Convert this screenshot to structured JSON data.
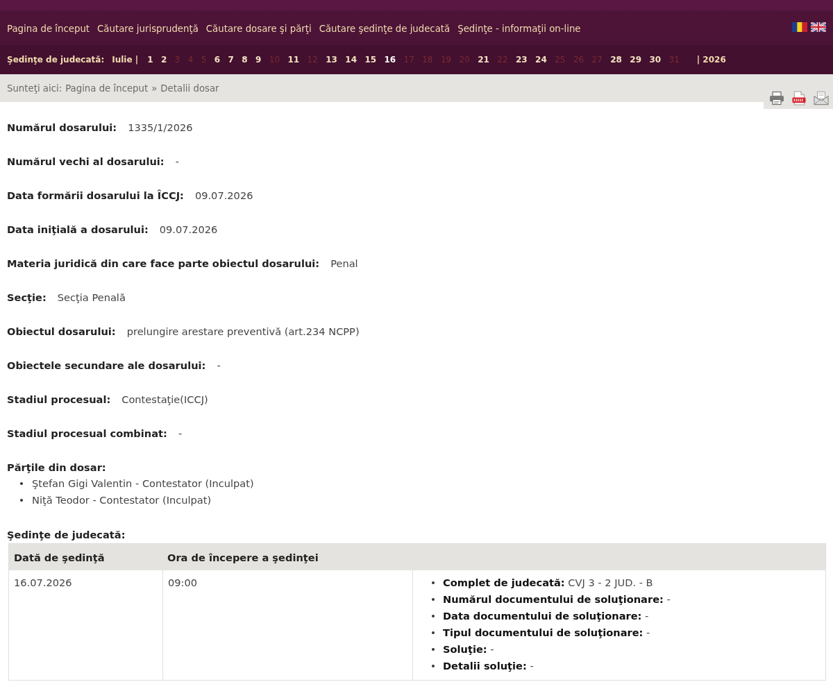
{
  "top_nav": {
    "items": [
      "Pagina de început",
      "Căutare jurisprudenţă",
      "Căutare dosare şi părţi",
      "Căutare şedinţe de judecată",
      "Şedinţe - informaţii on-line"
    ]
  },
  "sessions_nav": {
    "label": "Şedinţe de judecată:",
    "month": "Iulie |",
    "days": [
      {
        "day": "1",
        "has_sessions": true,
        "selected": false
      },
      {
        "day": "2",
        "has_sessions": true,
        "selected": false
      },
      {
        "day": "3",
        "has_sessions": false,
        "selected": false
      },
      {
        "day": "4",
        "has_sessions": false,
        "selected": false
      },
      {
        "day": "5",
        "has_sessions": false,
        "selected": false
      },
      {
        "day": "6",
        "has_sessions": true,
        "selected": false
      },
      {
        "day": "7",
        "has_sessions": true,
        "selected": false
      },
      {
        "day": "8",
        "has_sessions": true,
        "selected": false
      },
      {
        "day": "9",
        "has_sessions": true,
        "selected": false
      },
      {
        "day": "10",
        "has_sessions": false,
        "selected": false
      },
      {
        "day": "11",
        "has_sessions": true,
        "selected": false
      },
      {
        "day": "12",
        "has_sessions": false,
        "selected": false
      },
      {
        "day": "13",
        "has_sessions": true,
        "selected": false
      },
      {
        "day": "14",
        "has_sessions": true,
        "selected": false
      },
      {
        "day": "15",
        "has_sessions": true,
        "selected": false
      },
      {
        "day": "16",
        "has_sessions": true,
        "selected": true
      },
      {
        "day": "17",
        "has_sessions": false,
        "selected": false
      },
      {
        "day": "18",
        "has_sessions": false,
        "selected": false
      },
      {
        "day": "19",
        "has_sessions": false,
        "selected": false
      },
      {
        "day": "20",
        "has_sessions": false,
        "selected": false
      },
      {
        "day": "21",
        "has_sessions": true,
        "selected": false
      },
      {
        "day": "22",
        "has_sessions": false,
        "selected": false
      },
      {
        "day": "23",
        "has_sessions": true,
        "selected": false
      },
      {
        "day": "24",
        "has_sessions": true,
        "selected": false
      },
      {
        "day": "25",
        "has_sessions": false,
        "selected": false
      },
      {
        "day": "26",
        "has_sessions": false,
        "selected": false
      },
      {
        "day": "27",
        "has_sessions": false,
        "selected": false
      },
      {
        "day": "28",
        "has_sessions": true,
        "selected": false
      },
      {
        "day": "29",
        "has_sessions": true,
        "selected": false
      },
      {
        "day": "30",
        "has_sessions": true,
        "selected": false
      },
      {
        "day": "31",
        "has_sessions": false,
        "selected": false
      }
    ],
    "year": "| 2026"
  },
  "breadcrumb": {
    "prefix": "Sunteţi aici:",
    "link": "Pagina de început",
    "separator": "»",
    "current": "Detalii dosar"
  },
  "fields": [
    {
      "label": "Numărul dosarului:",
      "value": "1335/1/2026"
    },
    {
      "label": "Numărul vechi al dosarului:",
      "value": "-"
    },
    {
      "label": "Data formării dosarului la ÎCCJ:",
      "value": "09.07.2026"
    },
    {
      "label": "Data iniţială a dosarului:",
      "value": "09.07.2026"
    },
    {
      "label": "Materia juridică din care face parte obiectul dosarului:",
      "value": "Penal"
    },
    {
      "label": "Secţie:",
      "value": "Secţia Penală"
    },
    {
      "label": "Obiectul dosarului:",
      "value": "prelungire arestare preventivă (art.234 NCPP)"
    },
    {
      "label": "Obiectele secundare ale dosarului:",
      "value": "-"
    },
    {
      "label": "Stadiul procesual:",
      "value": "Contestaţie(ICCJ)"
    },
    {
      "label": "Stadiul procesual combinat:",
      "value": "-"
    }
  ],
  "parties": {
    "heading": "Părţile din dosar:",
    "items": [
      "Ştefan Gigi Valentin - Contestator (Inculpat)",
      "Niţă Teodor - Contestator (Inculpat)"
    ]
  },
  "sessions": {
    "heading": "Şedinţe de judecată:",
    "columns": [
      "Dată de şedinţă",
      "Ora de începere a şedinţei"
    ],
    "rows": [
      {
        "date": "16.07.2026",
        "time": "09:00",
        "details": [
          "**Complet de judecată:** CVJ 3 - 2 JUD. - B",
          "**Numărul documentului de soluţionare:** -",
          "**Data documentului de soluţionare:** -",
          "**Tipul documentului de soluţionare:** -",
          "**Soluţie:** -",
          "**Detalii soluţie:** -"
        ]
      }
    ]
  }
}
